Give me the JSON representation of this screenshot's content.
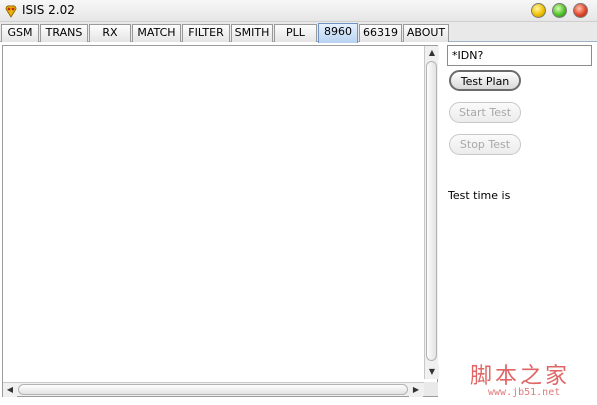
{
  "window": {
    "title": "ISIS 2.02",
    "controls": [
      "minimize",
      "maximize",
      "close"
    ]
  },
  "tabs": [
    {
      "label": "GSM"
    },
    {
      "label": "TRANS"
    },
    {
      "label": "RX"
    },
    {
      "label": "MATCH"
    },
    {
      "label": "FILTER"
    },
    {
      "label": "SMITH"
    },
    {
      "label": "PLL"
    },
    {
      "label": "8960",
      "active": true
    },
    {
      "label": "66319"
    },
    {
      "label": "ABOUT"
    }
  ],
  "command": {
    "value": "*IDN?"
  },
  "buttons": {
    "test_plan": "Test Plan",
    "start_test": "Start Test",
    "stop_test": "Stop Test"
  },
  "status": {
    "test_time": "Test time is"
  },
  "watermark": {
    "text": "脚本之家",
    "url": "www.jb51.net"
  },
  "colors": {
    "active_tab": "#b8d2f0",
    "watermark": "#e06666"
  }
}
